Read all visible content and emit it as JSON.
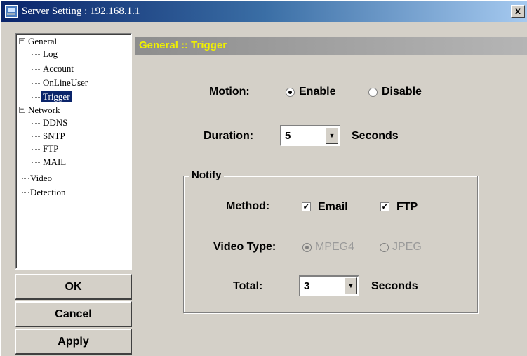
{
  "window": {
    "title": "Server Setting : 192.168.1.1",
    "close_icon": "close-icon",
    "close_glyph": "x"
  },
  "tree": {
    "general": {
      "label": "General",
      "expander": "−"
    },
    "log": "Log",
    "account": "Account",
    "online_user": "OnLineUser",
    "trigger": "Trigger",
    "network": {
      "label": "Network",
      "expander": "−"
    },
    "ddns": "DDNS",
    "sntp": "SNTP",
    "ftp": "FTP",
    "mail": "MAIL",
    "video": "Video",
    "detection": "Detection",
    "selected": "Trigger"
  },
  "buttons": {
    "ok": "OK",
    "cancel": "Cancel",
    "apply": "Apply"
  },
  "content": {
    "header": "General :: Trigger",
    "header_color": "#f0f000",
    "motion": {
      "label": "Motion:",
      "options": [
        "Enable",
        "Disable"
      ],
      "selected": "Enable"
    },
    "duration": {
      "label": "Duration:",
      "value": "5",
      "unit": "Seconds",
      "arrow": "▼"
    },
    "notify": {
      "title": "Notify",
      "method": {
        "label": "Method:",
        "email": {
          "label": "Email",
          "checked": true,
          "mark": "✓"
        },
        "ftp": {
          "label": "FTP",
          "checked": true,
          "mark": "✓"
        }
      },
      "video_type": {
        "label": "Video Type:",
        "options": [
          "MPEG4",
          "JPEG"
        ],
        "selected": "MPEG4",
        "disabled": true
      },
      "total": {
        "label": "Total:",
        "value": "3",
        "unit": "Seconds",
        "arrow": "▼"
      }
    }
  }
}
